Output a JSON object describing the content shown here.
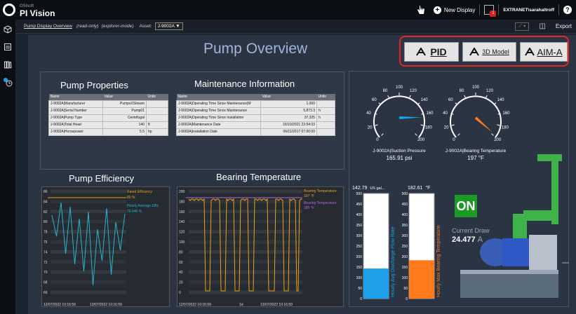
{
  "app": {
    "brand_small": "OSIsoft",
    "brand": "PI Vision"
  },
  "topbar": {
    "new_display": "New Display",
    "notifications": "1",
    "user": "EXTRANET\\sarahaltroff",
    "help": "?"
  },
  "subbar": {
    "display_name": "Pump Display Overview",
    "read_only": "(read-only)",
    "mode": "(explorer-mode)",
    "asset_label": "Asset:",
    "asset_value": "J-9002A",
    "export": "Export"
  },
  "page_title": "Pump Overview",
  "nav": {
    "pid": "PID",
    "model": "3D Model",
    "aim": "AIM-A"
  },
  "pump_properties": {
    "title": "Pump Properties",
    "headers": [
      "Name",
      "Value",
      "Units"
    ],
    "rows": [
      [
        "J-9002A|Manufacturer",
        "PumpsXStream",
        ""
      ],
      [
        "J-9002A|Serial Number",
        "Pump01",
        ""
      ],
      [
        "J-9002A|Pump Type",
        "Centrifugal",
        ""
      ],
      [
        "J-9002A|Total Head",
        "140",
        "ft"
      ],
      [
        "J-9002A|Horsepower",
        "5.5",
        "hp"
      ]
    ]
  },
  "maintenance": {
    "title": "Maintenance Information",
    "headers": [
      "Name",
      "Value",
      "Units"
    ],
    "rows": [
      [
        "J-9002A|Operating Time Since Maintenance|M",
        "1.000",
        ""
      ],
      [
        "J-9002A|Operating Time Since Maintenance",
        "5,873.3",
        "h"
      ],
      [
        "J-9002A|Operating Time Since Installation",
        "37,325",
        "h"
      ],
      [
        "J-9002A|Maintenance Date",
        "16/10/2021 23:54:33",
        ""
      ],
      [
        "J-9002A|Installation Date",
        "06/11/2017 07:00:00",
        ""
      ]
    ]
  },
  "efficiency": {
    "title": "Pump Efficiency",
    "legend1": "Rated Efficiency",
    "legend1_val": "80 %",
    "legend2": "Hourly Average Effic",
    "legend2_val": "79.646 %",
    "ticks": [
      "86",
      "84",
      "82",
      "80",
      "78",
      "76",
      "74",
      "72",
      "70",
      "68",
      "66"
    ],
    "x_start": "12/07/2022 10:16:59",
    "x_end": "13/07/2022 10:16:59",
    "color_rated": "#e8a317",
    "color_avg": "#29b6c8"
  },
  "bearing": {
    "title": "Bearing Temperature",
    "legend1": "Bearing Temperature",
    "legend1_val": "197 °F",
    "legend2": "Bearing Temperature",
    "legend2_val": "185 °F",
    "ticks": [
      "200",
      "180",
      "160",
      "140",
      "120",
      "100",
      "80",
      "60",
      "40",
      "20",
      "0"
    ],
    "x_start": "12/07/2022 10:16:59",
    "x_mid": "1d",
    "x_end": "13/07/2022 10:16:59",
    "color_line": "#e8a317",
    "color_limit": "#b466e0"
  },
  "gauges": {
    "suction": {
      "name": "J-9002A|Suction Pressure",
      "value": "165.91 psi",
      "color": "#1ea0e8"
    },
    "bearing": {
      "name": "J-9002A|Bearing Temperature",
      "value": "197 °F",
      "color": "#ff7a1a"
    },
    "ticks": [
      "0",
      "20",
      "40",
      "60",
      "80",
      "100",
      "120",
      "140",
      "160",
      "180",
      "200"
    ]
  },
  "bars": {
    "flow": {
      "value": "142.79",
      "unit": "US gal...",
      "label": "Hourly Avg Discharge Flow Rate",
      "level": 0.286,
      "color": "#1ea0e8"
    },
    "temp": {
      "value": "182.61",
      "unit": "°F",
      "label": "Hourly Max Bearing Temperature",
      "level": 0.365,
      "color": "#ff7a1a"
    },
    "ticks": [
      "500",
      "450",
      "400",
      "350",
      "300",
      "250",
      "200",
      "150",
      "100",
      "50",
      "0"
    ]
  },
  "status": {
    "on": "ON",
    "current_label": "Current Draw",
    "current_value": "24.477",
    "current_unit": "A"
  }
}
